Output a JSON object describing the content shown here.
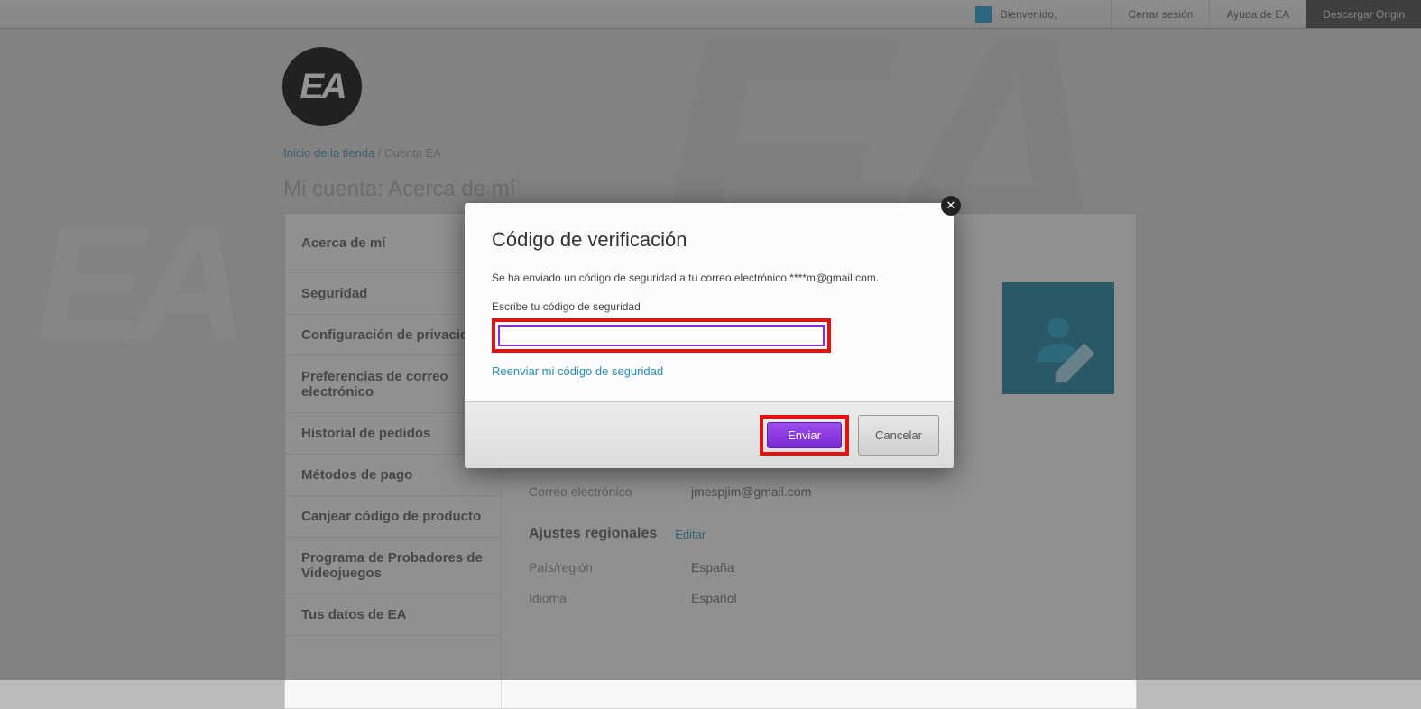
{
  "topbar": {
    "welcome": "Bienvenido,",
    "logout": "Cerrar sesión",
    "help": "Ayuda de EA",
    "download": "Descargar Origin"
  },
  "breadcrumb": {
    "home": "Inicio de la tienda",
    "sep": "/",
    "current": "Cuenta EA"
  },
  "page_title": "Mi cuenta: Acerca de mí",
  "logo_text": "EA",
  "sidebar": {
    "items": [
      {
        "label": "Acerca de mí"
      },
      {
        "label": "Seguridad"
      },
      {
        "label": "Configuración de privacidad"
      },
      {
        "label": "Preferencias de correo electrónico"
      },
      {
        "label": "Historial de pedidos"
      },
      {
        "label": "Métodos de pago"
      },
      {
        "label": "Canjear código de producto"
      },
      {
        "label": "Programa de Probadores de Videojuegos"
      },
      {
        "label": "Tus datos de EA"
      }
    ]
  },
  "content": {
    "email_label": "Correo electrónico",
    "email_value": "jmespjim@gmail.com",
    "regional_header": "Ajustes regionales",
    "edit_link": "Editar",
    "country_label": "País/región",
    "country_value": "España",
    "lang_label": "Idioma",
    "lang_value": "Español"
  },
  "modal": {
    "title": "Código de verificación",
    "text_prefix": "Se ha enviado un código de seguridad a tu correo electrónico ",
    "email_masked": "****m@gmail.com",
    "text_suffix": ".",
    "label": "Escribe tu código de seguridad",
    "resend": "Reenviar mi código de seguridad",
    "submit": "Enviar",
    "cancel": "Cancelar"
  }
}
